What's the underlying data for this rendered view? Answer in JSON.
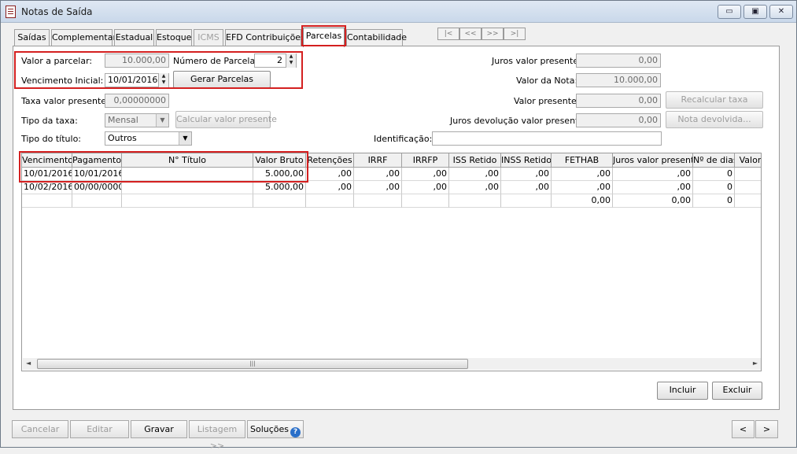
{
  "window": {
    "title": "Notas de Saída",
    "min_label": "▭",
    "max_label": "▣",
    "close_label": "✕"
  },
  "tabs": [
    "Saídas",
    "Complementar",
    "Estadual",
    "Estoque",
    "ICMS",
    "EFD Contribuições",
    "Parcelas",
    "Contabilidade"
  ],
  "nav": [
    "|<",
    "<<",
    ">>",
    ">|"
  ],
  "form": {
    "valor_parcelar_label": "Valor a parcelar:",
    "valor_parcelar": "10.000,00",
    "num_parcelas_label": "Número de Parcelas:",
    "num_parcelas": "2",
    "vencimento_label": "Vencimento Inicial:",
    "vencimento": "10/01/2016",
    "gerar_label": "Gerar Parcelas",
    "taxa_label": "Taxa valor presente:",
    "taxa": "0,00000000",
    "tipo_taxa_label": "Tipo da taxa:",
    "tipo_taxa": "Mensal",
    "calcular_label": "Calcular valor presente",
    "tipo_titulo_label": "Tipo do título:",
    "tipo_titulo": "Outros",
    "identificacao_label": "Identificação:",
    "identificacao": "",
    "juros_vp_label": "Juros valor presente:",
    "juros_vp": "0,00",
    "valor_nota_label": "Valor da Nota:",
    "valor_nota": "10.000,00",
    "valor_presente_label": "Valor presente:",
    "valor_presente": "0,00",
    "recalcular_label": "Recalcular taxa",
    "juros_dev_label": "Juros devolução valor presente:",
    "juros_dev": "0,00",
    "nota_dev_label": "Nota devolvida..."
  },
  "grid": {
    "columns": [
      "Vencimento",
      "Pagamento",
      "N° Título",
      "Valor Bruto",
      "Retenções",
      "IRRF",
      "IRRFP",
      "ISS Retido",
      "INSS Retido",
      "FETHAB",
      "Juros valor presente",
      "Nº de dias",
      "Valor"
    ],
    "rows": [
      [
        "10/01/2016",
        "10/01/2016",
        "",
        "5.000,00",
        ",00",
        ",00",
        ",00",
        ",00",
        ",00",
        ",00",
        ",00",
        "0",
        ""
      ],
      [
        "10/02/2016",
        "00/00/0000",
        "",
        "5.000,00",
        ",00",
        ",00",
        ",00",
        ",00",
        ",00",
        ",00",
        ",00",
        "0",
        ""
      ],
      [
        "",
        "",
        "",
        "",
        "",
        "",
        "",
        "",
        "",
        "0,00",
        "0,00",
        "0",
        ""
      ]
    ]
  },
  "actions": {
    "incluir": "Incluir",
    "excluir": "Excluir"
  },
  "footer": {
    "cancelar": "Cancelar",
    "editar": "Editar",
    "gravar": "Gravar",
    "listagem": "Listagem >>",
    "solucoes": "Soluções",
    "help": "?",
    "prev": "<",
    "next": ">"
  }
}
